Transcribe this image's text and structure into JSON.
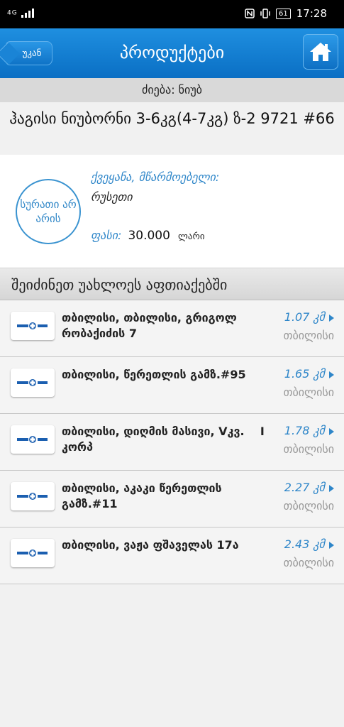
{
  "status": {
    "network": "4G",
    "time": "17:28",
    "battery": "61"
  },
  "nav": {
    "back_label": "უკან",
    "title": "პროდუქტები"
  },
  "search": {
    "text": "ძიება: ნიუბ"
  },
  "product": {
    "title": "ჰაგისი ნიუბორნი 3-6კგ(4-7კგ) ზ-2 9721 #66",
    "no_image": "სურათი არ არის",
    "country_label": "ქვეყანა, მწარმოებელი:",
    "country_value": "რუსეთი",
    "price_label": "ფასი:",
    "price_value": "30.000",
    "price_currency": "ლარი"
  },
  "section": {
    "title": "შეიძინეთ უახლოეს აფთიაქებში"
  },
  "pharmacies": [
    {
      "address": "თბილისი, თბილისი, გრიგოლ რობაქიძის 7",
      "distance": "1.07 კმ",
      "city": "თბილისი"
    },
    {
      "address": "თბილისი, წერეთლის გამზ.#95",
      "distance": "1.65 კმ",
      "city": "თბილისი"
    },
    {
      "address": "თბილისი, დიღმის მასივი, Vკვ.    I კორპ",
      "distance": "1.78 კმ",
      "city": "თბილისი"
    },
    {
      "address": "თბილისი, აკაკი წერეთლის გამზ.#11",
      "distance": "2.27 კმ",
      "city": "თბილისი"
    },
    {
      "address": "თბილისი, ვაჟა ფშაველას 17ა",
      "distance": "2.43 კმ",
      "city": "თბილისი"
    }
  ],
  "colors": {
    "accent": "#2e86c9",
    "navbar": "#0a6fc4",
    "logo_blue": "#1b5fb0"
  }
}
